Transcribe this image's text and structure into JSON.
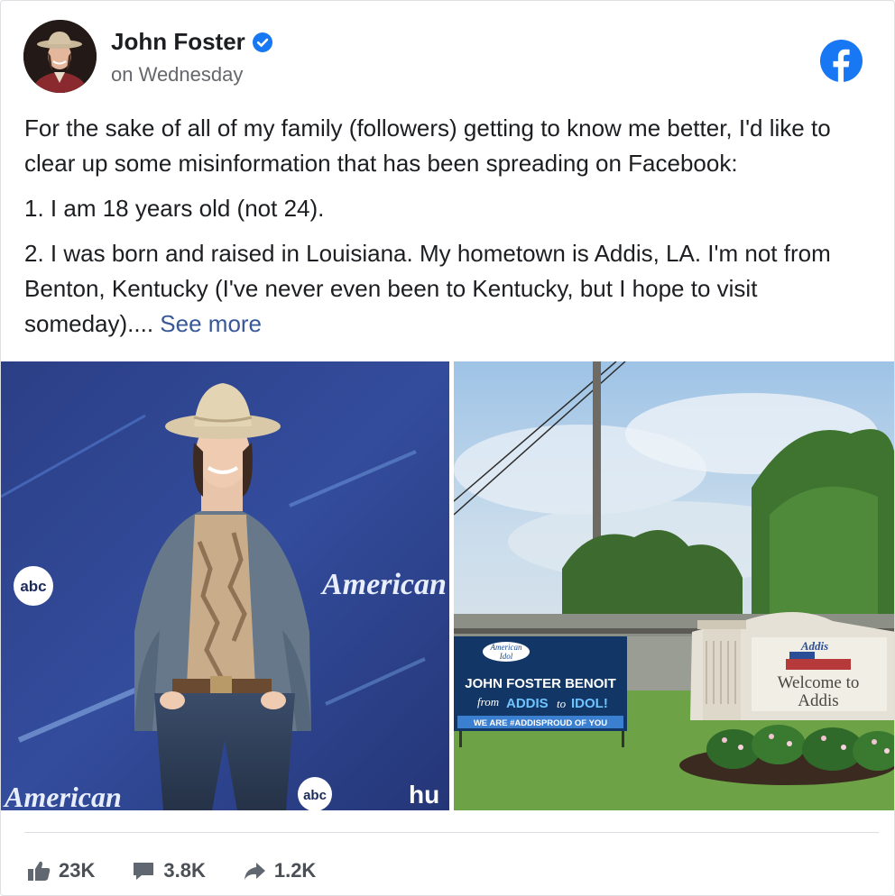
{
  "post": {
    "author": "John Foster",
    "timestamp": "on Wednesday",
    "paragraphs": [
      "For the sake of all of my family (followers) getting to know me better, I'd like to clear up some misinformation that has been spreading on Facebook:",
      "1. I am 18 years old (not 24).",
      "2. I was born and raised in Louisiana. My hometown is Addis, LA. I'm not from Benton, Kentucky (I've never even been to Kentucky, but I hope to visit someday)...."
    ],
    "see_more": "See more"
  },
  "photos": {
    "left": {
      "backdrop_text": "American",
      "backdrop_text_2": "American",
      "abc_logo": "abc",
      "abc_logo_2": "abc",
      "hulu_text": "hu"
    },
    "right": {
      "banner_logo_line1": "American",
      "banner_logo_line2": "Idol",
      "banner_line1": "JOHN FOSTER BENOIT",
      "banner_from": "from",
      "banner_addis": "ADDIS",
      "banner_to": "to",
      "banner_idol": "IDOL!",
      "banner_footer": "WE ARE #ADDISPROUD OF YOU",
      "sign_top": "Addis",
      "sign_welcome": "Welcome to",
      "sign_town": "Addis"
    }
  },
  "stats": {
    "likes": "23K",
    "comments": "3.8K",
    "shares": "1.2K"
  },
  "icons": {
    "verified": "verified-badge-icon",
    "facebook": "facebook-logo-icon",
    "like": "thumbs-up-icon",
    "comment": "comment-icon",
    "share": "share-icon"
  },
  "colors": {
    "facebook_blue": "#1877f2",
    "link": "#385898",
    "secondary_text": "#65676b",
    "stat_text": "#4b4f56"
  }
}
